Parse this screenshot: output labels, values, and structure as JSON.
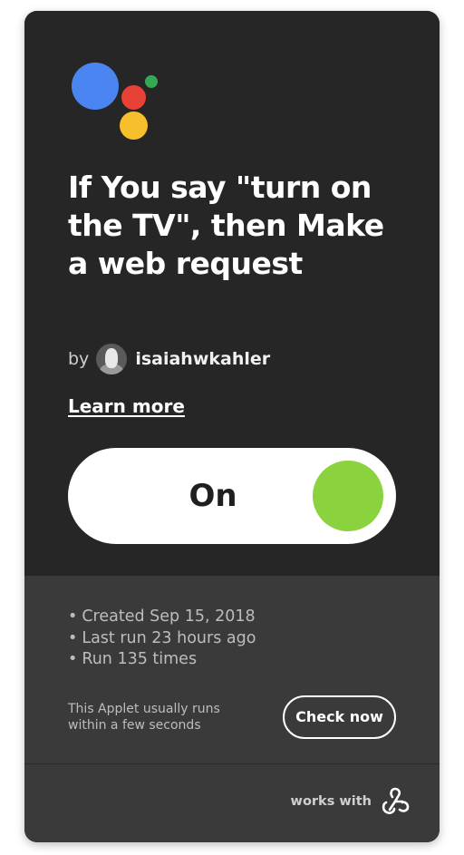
{
  "applet": {
    "title": "If You say \"turn on the TV\", then Make a web request",
    "by_label": "by",
    "author": "isaiahwkahler",
    "learn_more": "Learn more",
    "toggle": {
      "label": "On",
      "state": "on"
    }
  },
  "stats": {
    "items": [
      "Created Sep 15, 2018",
      "Last run 23 hours ago",
      "Run 135 times"
    ],
    "runs_note": "This Applet usually runs within a few seconds",
    "check_now": "Check now"
  },
  "footer": {
    "works_with": "works with",
    "service_icon": "webhooks-icon"
  },
  "colors": {
    "card_bg": "#262626",
    "stats_bg": "#3a3a3a",
    "toggle_knob": "#8ad33e",
    "assistant_blue": "#4b85f1",
    "assistant_red": "#e74235",
    "assistant_yellow": "#f8bf2c",
    "assistant_green": "#34a853"
  }
}
